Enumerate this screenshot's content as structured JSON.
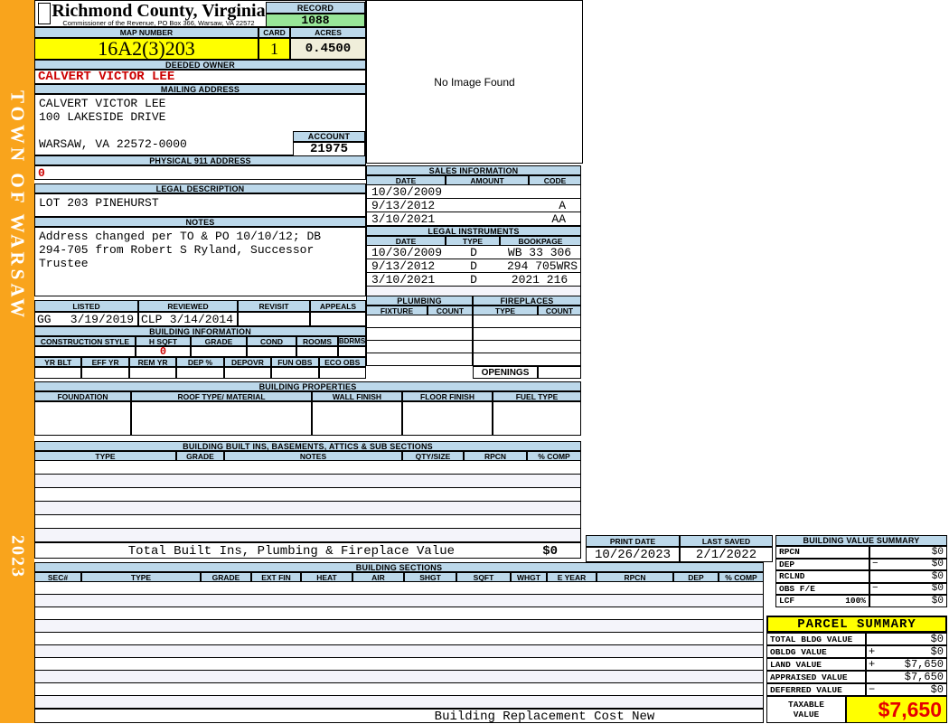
{
  "sidebar": {
    "town_label": "TOWN OF WARSAW",
    "year_label": "2023"
  },
  "header": {
    "title": "Richmond County, Virginia",
    "subtitle": "Commissioner of the Revenue, PO Box 366, Warsaw, VA 22572",
    "record_label": "RECORD",
    "record_value": "1088",
    "map_number_label": "MAP NUMBER",
    "map_number_value": "16A2(3)203",
    "card_label": "CARD",
    "card_value": "1",
    "acres_label": "ACRES",
    "acres_value": "0.4500"
  },
  "owner": {
    "deeded_owner_label": "DEEDED OWNER",
    "deeded_owner_value": "CALVERT VICTOR LEE",
    "mailing_label": "MAILING ADDRESS",
    "mailing_line1": "CALVERT VICTOR LEE",
    "mailing_line2": "100 LAKESIDE DRIVE",
    "mailing_line3": "WARSAW, VA 22572-0000",
    "account_label": "ACCOUNT",
    "account_value": "21975",
    "physical_label": "PHYSICAL 911 ADDRESS",
    "physical_value": "0"
  },
  "legal_description": {
    "title": "LEGAL DESCRIPTION",
    "value": "LOT 203 PINEHURST"
  },
  "notes": {
    "title": "NOTES",
    "line1": "Address changed per TO & PO 10/10/12; DB",
    "line2": "294-705 from Robert S Ryland, Successor",
    "line3": "Trustee"
  },
  "visits": {
    "listed_label": "LISTED",
    "reviewed_label": "REVIEWED",
    "revisit_label": "REVISIT",
    "appeals_label": "APPEALS",
    "listed_by": "GG",
    "listed_date": "3/19/2019",
    "reviewed_by": "CLP",
    "reviewed_date": "3/14/2014",
    "revisit_value": "",
    "appeals_value": ""
  },
  "building_information": {
    "title": "BUILDING INFORMATION",
    "col1": "CONSTRUCTION STYLE",
    "col2": "H SQFT",
    "col3": "GRADE",
    "col4": "COND",
    "col5": "ROOMS",
    "col6": "BDRMS",
    "h_sqft_value": "0",
    "col7": "YR BLT",
    "col8": "EFF YR",
    "col9": "REM YR",
    "col10": "DEP %",
    "col11": "DEPOVR",
    "col12": "FUN OBS",
    "col13": "ECO OBS"
  },
  "building_properties": {
    "title": "BUILDING PROPERTIES",
    "col1": "FOUNDATION",
    "col2": "ROOF TYPE/ MATERIAL",
    "col3": "WALL FINISH",
    "col4": "FLOOR FINISH",
    "col5": "FUEL TYPE"
  },
  "built_ins": {
    "title": "BUILDING BUILT INS, BASEMENTS, ATTICS & SUB SECTIONS",
    "col1": "TYPE",
    "col2": "GRADE",
    "col3": "NOTES",
    "col4": "QTY/SIZE",
    "col5": "RPCN",
    "col6": "% COMP",
    "total_label": "Total Built Ins, Plumbing & Fireplace Value",
    "total_value": "$0"
  },
  "image_panel": {
    "text": "No Image Found"
  },
  "sales": {
    "title": "SALES INFORMATION",
    "col1": "DATE",
    "col2": "AMOUNT",
    "col3": "CODE",
    "rows": [
      {
        "date": "10/30/2009",
        "amount": "",
        "code": ""
      },
      {
        "date": "9/13/2012",
        "amount": "",
        "code": "A"
      },
      {
        "date": "3/10/2021",
        "amount": "",
        "code": "AA"
      }
    ]
  },
  "instruments": {
    "title": "LEGAL INSTRUMENTS",
    "col1": "DATE",
    "col2": "TYPE",
    "col3": "BOOKPAGE",
    "rows": [
      {
        "date": "10/30/2009",
        "type": "D",
        "bookpage": "WB 33 306"
      },
      {
        "date": "9/13/2012",
        "type": "D",
        "bookpage": "294 705WRS"
      },
      {
        "date": "3/10/2021",
        "type": "D",
        "bookpage": "2021 216"
      }
    ]
  },
  "plumbing": {
    "title": "PLUMBING",
    "col1": "FIXTURE",
    "col2": "COUNT"
  },
  "fireplaces": {
    "title": "FIREPLACES",
    "col1": "TYPE",
    "col2": "COUNT",
    "openings_label": "OPENINGS"
  },
  "print_info": {
    "print_date_label": "PRINT DATE",
    "print_date_value": "10/26/2023",
    "last_saved_label": "LAST SAVED",
    "last_saved_value": "2/1/2022"
  },
  "building_value_summary": {
    "title": "BUILDING VALUE SUMMARY",
    "rows": [
      {
        "label": "RPCN",
        "op": "",
        "value": "$0"
      },
      {
        "label": "DEP",
        "op": "−",
        "value": "$0"
      },
      {
        "label": "RCLND",
        "op": "",
        "value": "$0"
      },
      {
        "label": "OBS F/E",
        "op": "−",
        "value": "$0"
      },
      {
        "label": "LCF",
        "pct": "100%",
        "op": "",
        "value": "$0"
      }
    ]
  },
  "building_sections": {
    "title": "BUILDING SECTIONS",
    "col1": "SEC#",
    "col2": "TYPE",
    "col3": "GRADE",
    "col4": "EXT FIN",
    "col5": "HEAT",
    "col6": "AIR",
    "col7": "SHGT",
    "col8": "SQFT",
    "col9": "WHGT",
    "col10": "E YEAR",
    "col11": "RPCN",
    "col12": "DEP",
    "col13": "% COMP",
    "footer_label": "Building Replacement Cost New"
  },
  "parcel_summary": {
    "title": "PARCEL SUMMARY",
    "rows": [
      {
        "label": "TOTAL BLDG VALUE",
        "op": "",
        "value": "$0"
      },
      {
        "label": "OBLDG VALUE",
        "op": "+",
        "value": "$0"
      },
      {
        "label": "LAND VALUE",
        "op": "+",
        "value": "$7,650"
      },
      {
        "label": "APPRAISED VALUE",
        "op": "",
        "value": "$7,650"
      },
      {
        "label": "DEFERRED VALUE",
        "op": "−",
        "value": "$0"
      }
    ],
    "taxable_label_line1": "TAXABLE",
    "taxable_label_line2": "VALUE",
    "taxable_value": "$7,650"
  },
  "colors": {
    "accent_orange": "#F9A41C",
    "header_blue": "#BCD8EA",
    "record_green": "#98E698",
    "highlight_yellow": "#FFFF00",
    "cream": "#F0EEDA",
    "alert_red": "#CC0000",
    "taxable_red": "#E60000"
  }
}
